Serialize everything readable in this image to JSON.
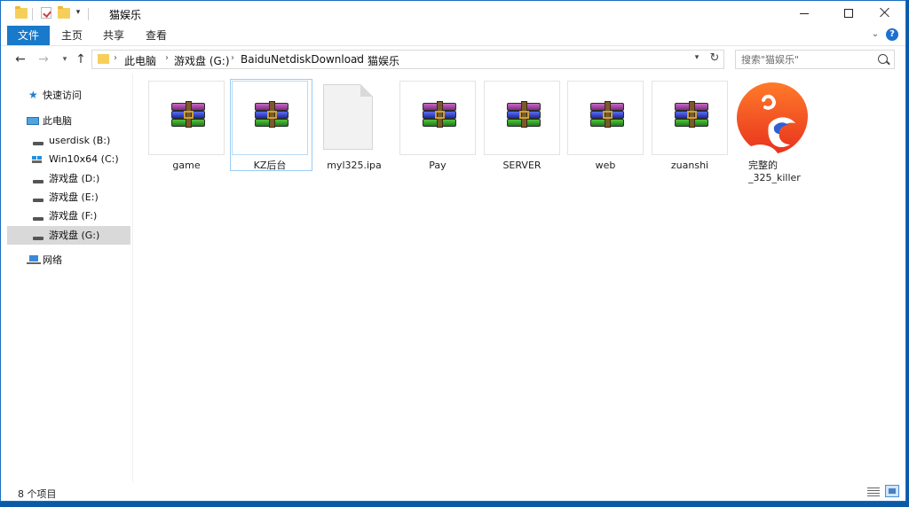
{
  "window": {
    "title": "猫娱乐"
  },
  "ribbon": {
    "tabs": [
      {
        "label": "文件",
        "active": true
      },
      {
        "label": "主页"
      },
      {
        "label": "共享"
      },
      {
        "label": "查看"
      }
    ],
    "help": "?"
  },
  "address": {
    "crumbs": [
      "此电脑",
      "游戏盘 (G:)",
      "BaiduNetdiskDownload",
      "猫娱乐"
    ]
  },
  "search": {
    "placeholder": "搜索\"猫娱乐\""
  },
  "navpane": {
    "quick_access": "快速访问",
    "this_pc": "此电脑",
    "drives": [
      {
        "label": "userdisk (B:)",
        "icon": "drive-icon"
      },
      {
        "label": "Win10x64 (C:)",
        "icon": "windows-drive-icon"
      },
      {
        "label": "游戏盘 (D:)",
        "icon": "drive-icon"
      },
      {
        "label": "游戏盘 (E:)",
        "icon": "drive-icon"
      },
      {
        "label": "游戏盘 (F:)",
        "icon": "drive-icon"
      },
      {
        "label": "游戏盘 (G:)",
        "icon": "drive-icon",
        "selected": true
      }
    ],
    "network": "网络"
  },
  "files": [
    {
      "name": "game",
      "type": "archive",
      "icon": "winrar-archive-icon"
    },
    {
      "name": "KZ后台",
      "type": "archive",
      "icon": "winrar-archive-icon",
      "selected": true
    },
    {
      "name": "myl325.ipa",
      "type": "file",
      "icon": "generic-file-icon"
    },
    {
      "name": "Pay",
      "type": "archive",
      "icon": "winrar-archive-icon"
    },
    {
      "name": "SERVER",
      "type": "archive",
      "icon": "winrar-archive-icon"
    },
    {
      "name": "web",
      "type": "archive",
      "icon": "winrar-archive-icon"
    },
    {
      "name": "zuanshi",
      "type": "archive",
      "icon": "winrar-archive-icon"
    },
    {
      "name_line1": "完整的",
      "name_line2": "_325_killer",
      "type": "app",
      "icon": "killer-app-icon"
    }
  ],
  "status": {
    "count": "8 个项目"
  },
  "colors": {
    "accent": "#1979ca",
    "desktop": "#0a5aa8",
    "selection": "#99ccf4"
  }
}
